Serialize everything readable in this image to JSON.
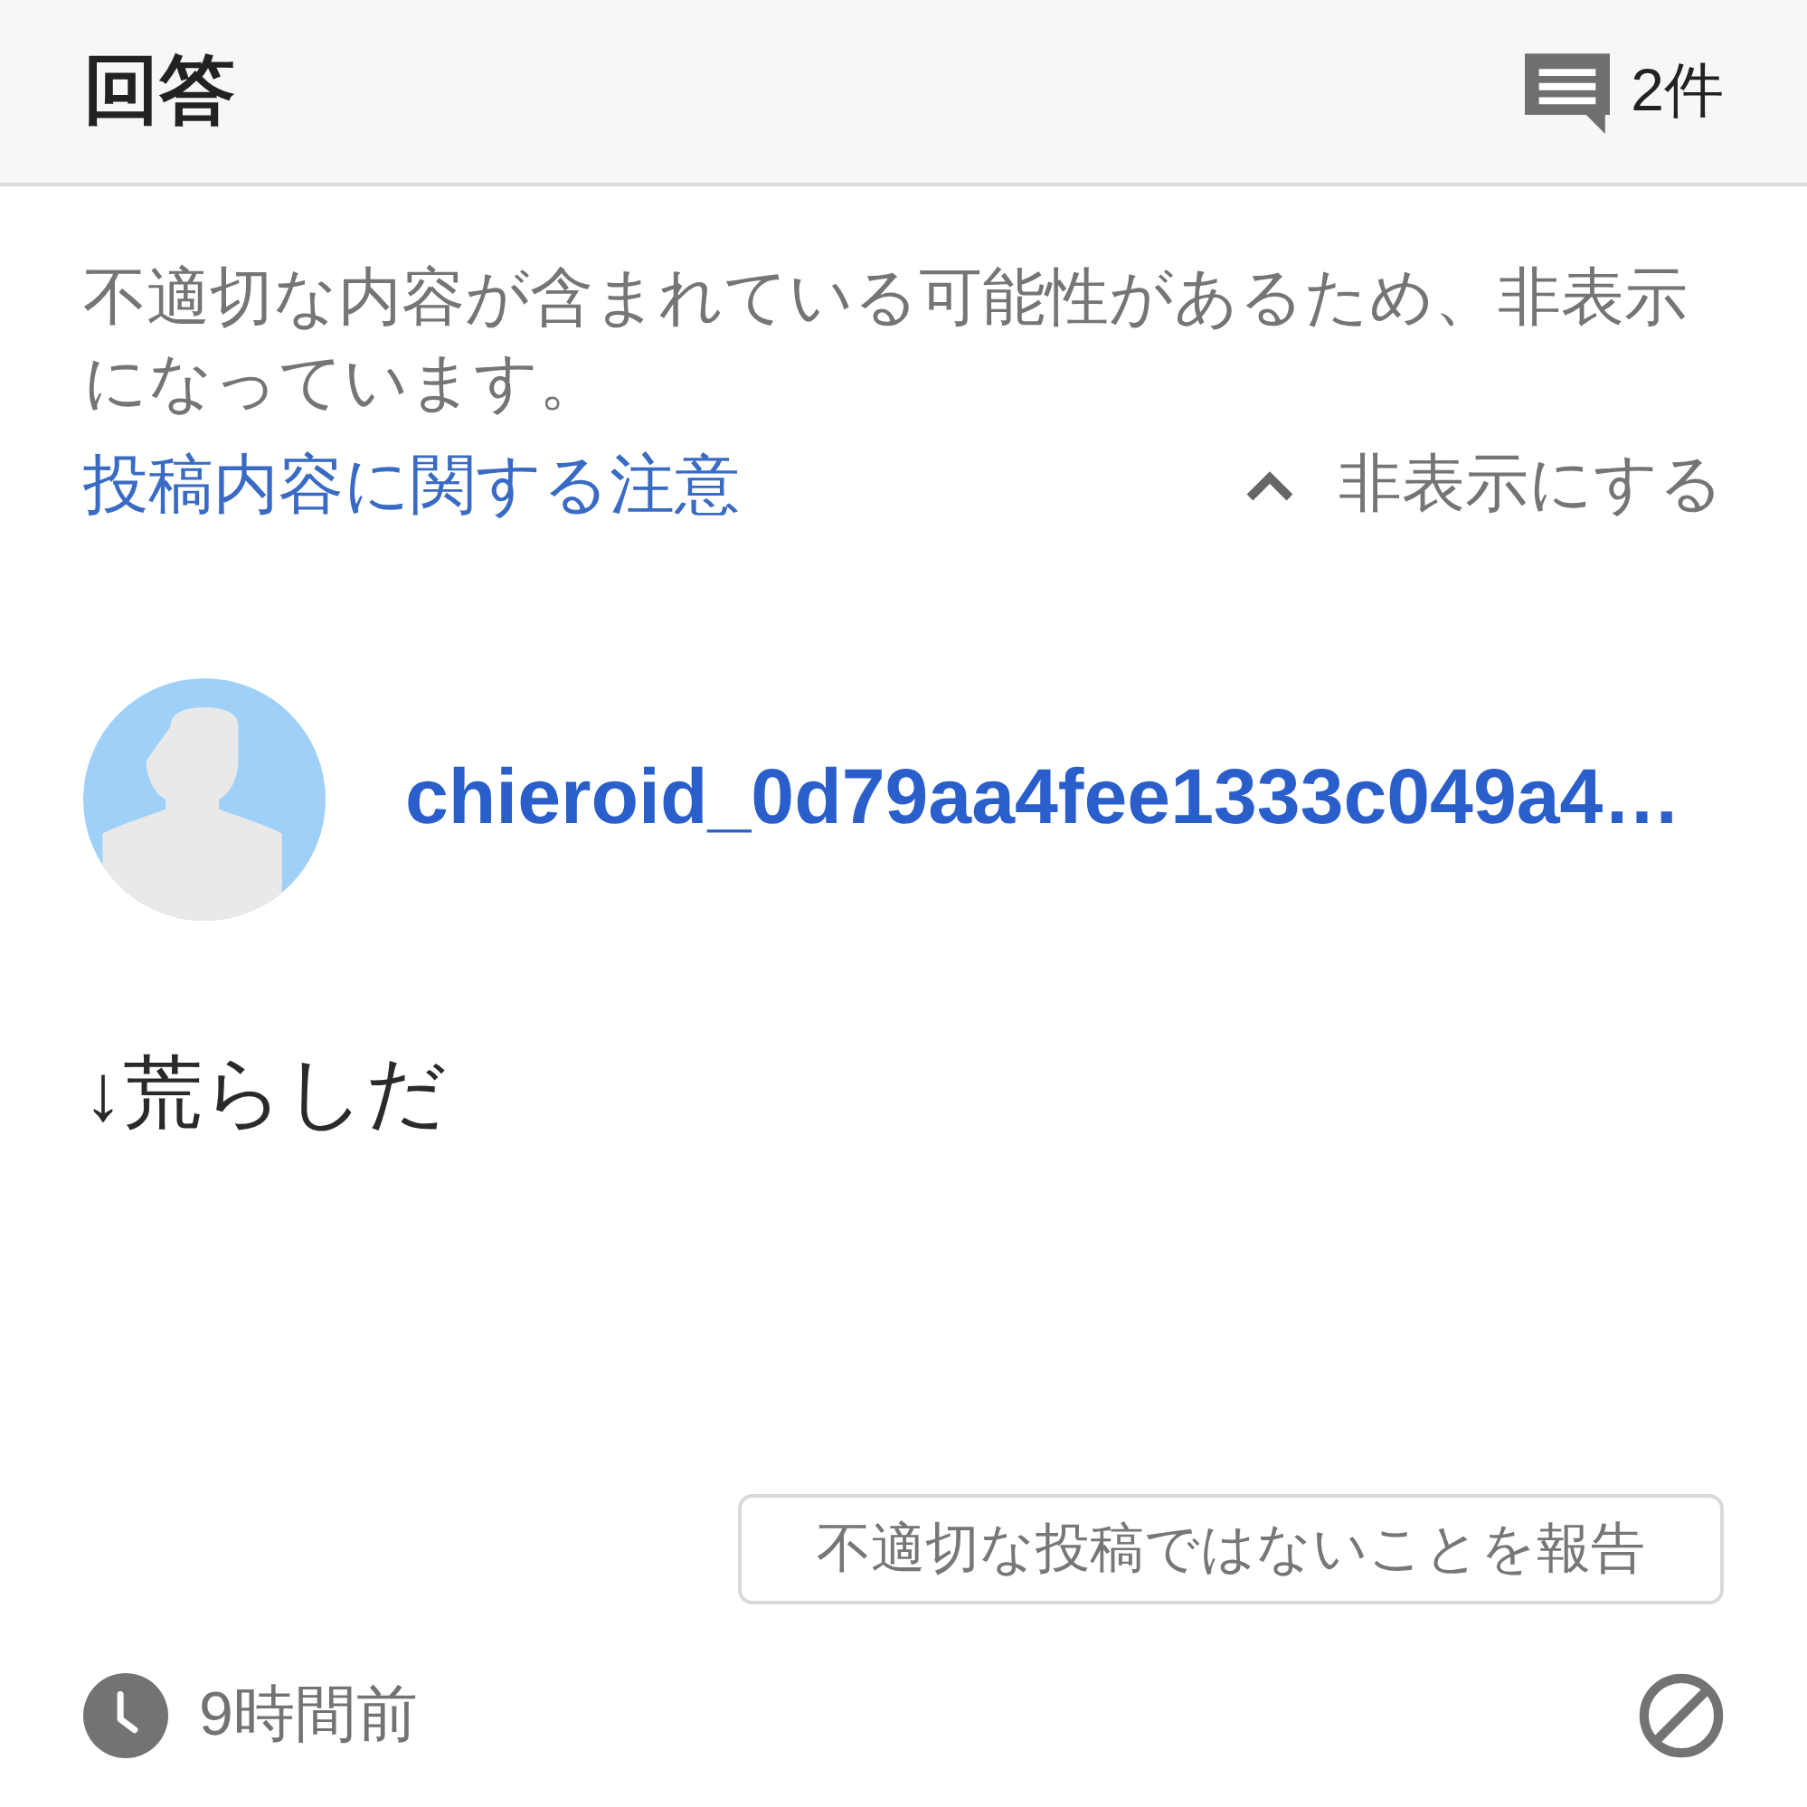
{
  "header": {
    "title": "回答",
    "answer_count": "2件"
  },
  "notice": {
    "message": "不適切な内容が含まれている可能性があるため、非表示になっています。",
    "link": "投稿内容に関する注意",
    "hide_toggle": {
      "label": "非表示にする",
      "expanded": true
    }
  },
  "answer": {
    "user": "chieroid_0d79aa4fee1333c049a4…",
    "body": "↓荒らしだ",
    "report_button": "不適切な投稿ではないことを報告",
    "time": "9時間前"
  }
}
